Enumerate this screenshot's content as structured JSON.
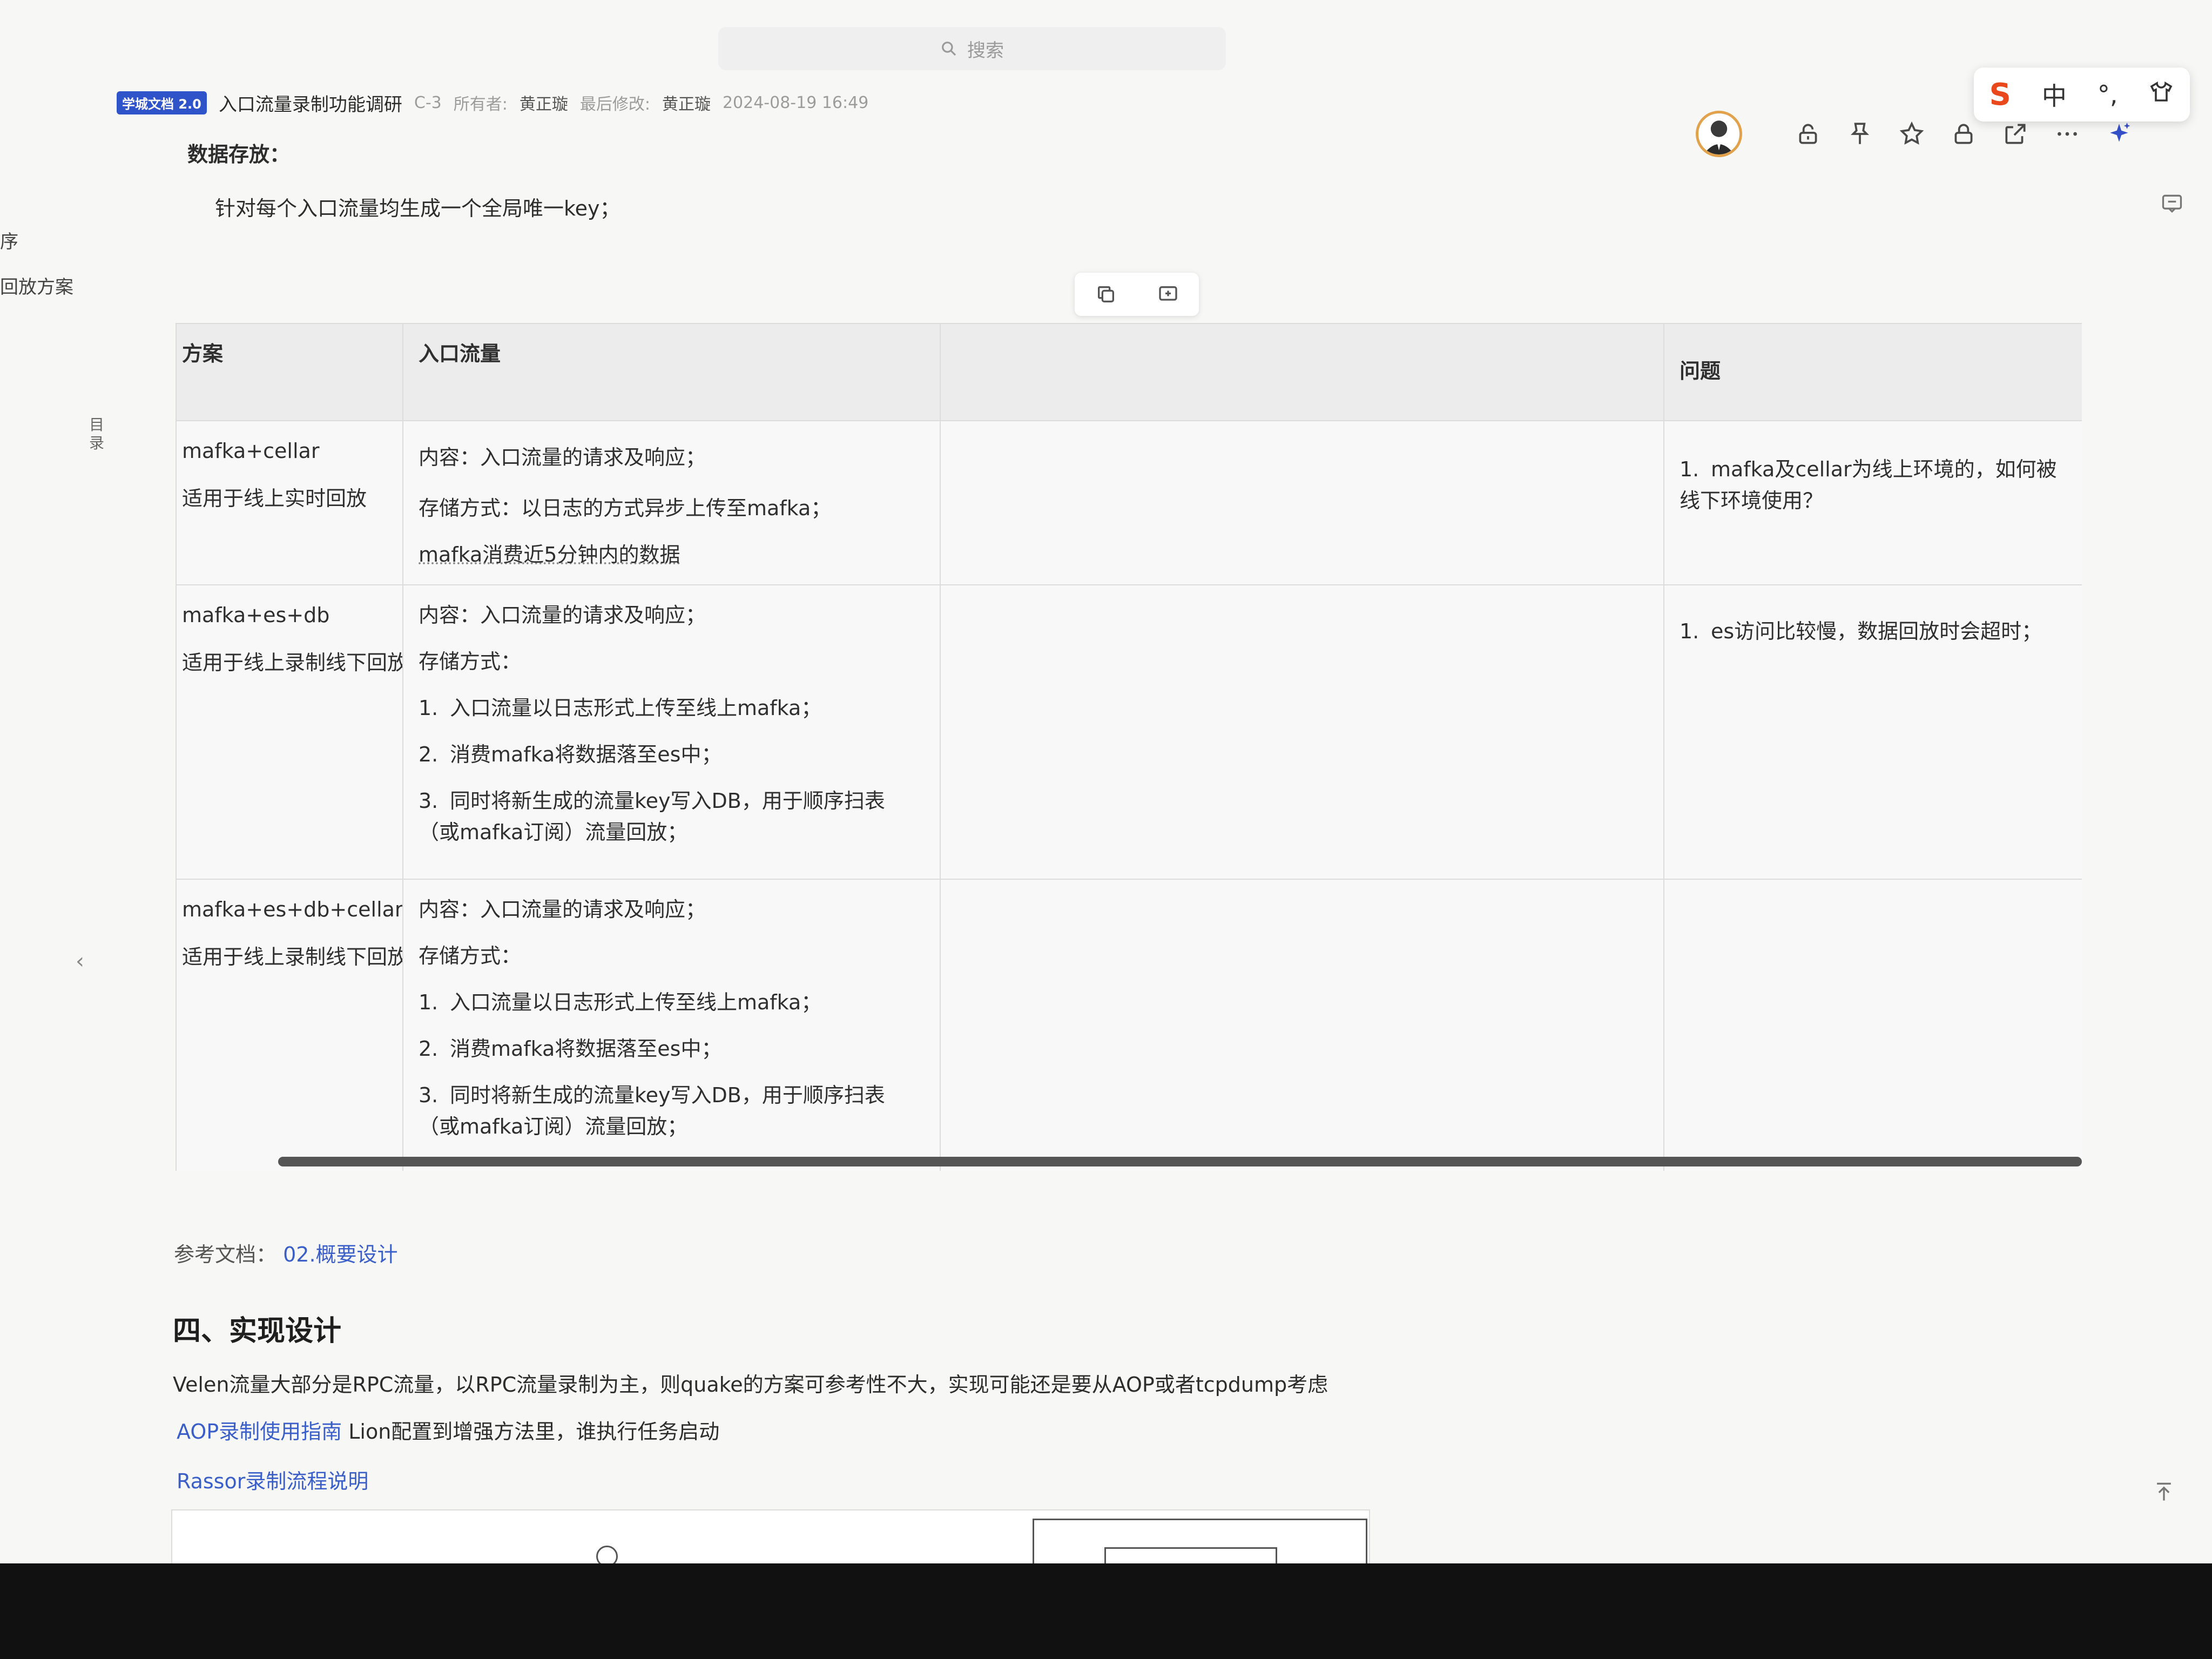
{
  "search": {
    "placeholder": "搜索"
  },
  "header": {
    "brand": "学城文档 2.0",
    "title": "入口流量录制功能调研",
    "version": "C-3",
    "owner_label": "所有者:",
    "owner": "黄正璇",
    "modified_label": "最后修改:",
    "modifier": "黄正璇",
    "modified_time": "2024-08-19 16:49"
  },
  "ime": {
    "logo": "S",
    "mode": "中",
    "punct": "°,"
  },
  "sidebar": {
    "items": [
      "序",
      "回放方案"
    ],
    "toc_label": "目录",
    "collapse": "‹"
  },
  "content": {
    "section_label": "数据存放：",
    "section_line": "针对每个入口流量均生成一个全局唯一key；"
  },
  "table": {
    "headers": [
      "方案",
      "入口流量",
      "",
      "问题"
    ],
    "rows": [
      {
        "scheme": [
          "mafka+cellar",
          "适用于线上实时回放"
        ],
        "content": "内容：入口流量的请求及响应；",
        "storage": "存储方式：以日志的方式异步上传至mafka；",
        "extra": "mafka消费近5分钟内的数据",
        "issues": [
          "mafka及cellar为线上环境的，如何被线下环境使用？"
        ]
      },
      {
        "scheme": [
          "mafka+es+db",
          "适用于线上录制线下回放"
        ],
        "content": "内容：入口流量的请求及响应；",
        "storage": "存储方式：",
        "steps": [
          "入口流量以日志形式上传至线上mafka；",
          "消费mafka将数据落至es中；",
          "同时将新生成的流量key写入DB，用于顺序扫表（或mafka订阅）流量回放；"
        ],
        "issues": [
          "es访问比较慢，数据回放时会超时；"
        ]
      },
      {
        "scheme": [
          "mafka+es+db+cellar",
          "适用于线上录制线下回放"
        ],
        "content": "内容：入口流量的请求及响应；",
        "storage": "存储方式：",
        "steps": [
          "入口流量以日志形式上传至线上mafka；",
          "消费mafka将数据落至es中；",
          "同时将新生成的流量key写入DB，用于顺序扫表（或mafka订阅）流量回放；"
        ],
        "issues": []
      }
    ]
  },
  "reference": {
    "label": "参考文档：",
    "link": "02.概要设计"
  },
  "section4": {
    "title": "四、实现设计",
    "para1": "Velen流量大部分是RPC流量，以RPC流量录制为主，则quake的方案可参考性不大，实现可能还是要从AOP或者tcpdump考虑",
    "para2_link": "AOP录制使用指南",
    "para2_text": " Lion配置到增强方法里，谁执行任务启动",
    "para3_link": "Rassor录制流程说明"
  }
}
